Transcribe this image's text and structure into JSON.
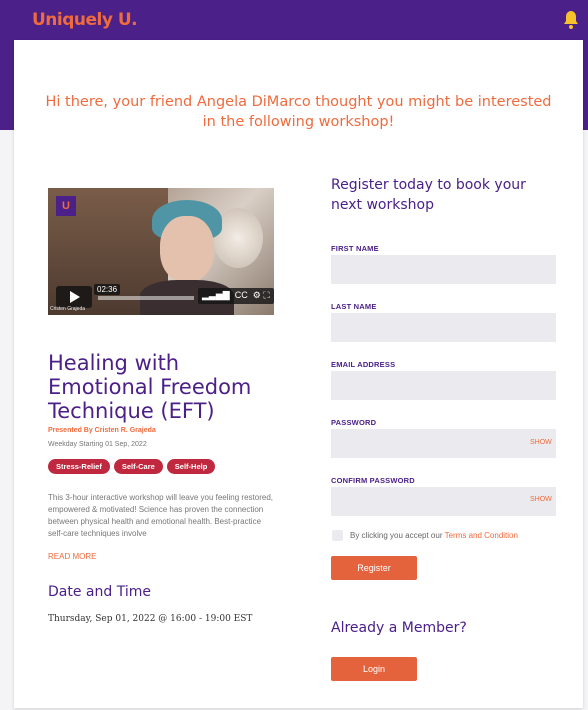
{
  "brand": {
    "logo_text": "Uniquely U.",
    "accent_color": "#ef6b3e",
    "primary_color": "#4b2088"
  },
  "header": {
    "notification_icon": "bell-icon"
  },
  "invite_message": "Hi there, your friend Angela DiMarco thought you might be interested in the following workshop!",
  "video": {
    "badge": "U",
    "timestamp": "02:36",
    "caption": "Cristen Grajeda",
    "controls": [
      "signal-icon",
      "cc-icon",
      "gear-icon",
      "fullscreen-icon"
    ]
  },
  "workshop": {
    "title": "Healing with Emotional Freedom Technique (EFT)",
    "presenter": "Presented By Cristen R. Grajeda",
    "schedule": "Weekday Starting 01 Sep, 2022",
    "tags": [
      "Stress-Relief",
      "Self-Care",
      "Self-Help"
    ],
    "description": "This 3-hour interactive workshop will leave you feeling restored, empowered & motivated! Science has proven the connection between physical health and emotional health. Best-practice self-care techniques involve",
    "read_more": "READ MORE",
    "date_time_title": "Date and Time",
    "date_time_value": "Thursday, Sep 01, 2022 @ 16:00 - 19:00 EST"
  },
  "register": {
    "title": "Register today to book your next workshop",
    "fields": {
      "first_name": {
        "label": "FIRST NAME",
        "value": ""
      },
      "last_name": {
        "label": "LAST NAME",
        "value": ""
      },
      "email": {
        "label": "EMAIL ADDRESS",
        "value": ""
      },
      "password": {
        "label": "PASSWORD",
        "value": "",
        "toggle": "SHOW"
      },
      "confirm_password": {
        "label": "CONFIRM PASSWORD",
        "value": "",
        "toggle": "SHOW"
      }
    },
    "terms_prefix": "By clicking you accept our ",
    "terms_link": "Terms and Condition",
    "submit_label": "Register"
  },
  "member": {
    "title": "Already a Member?",
    "login_label": "Login"
  }
}
